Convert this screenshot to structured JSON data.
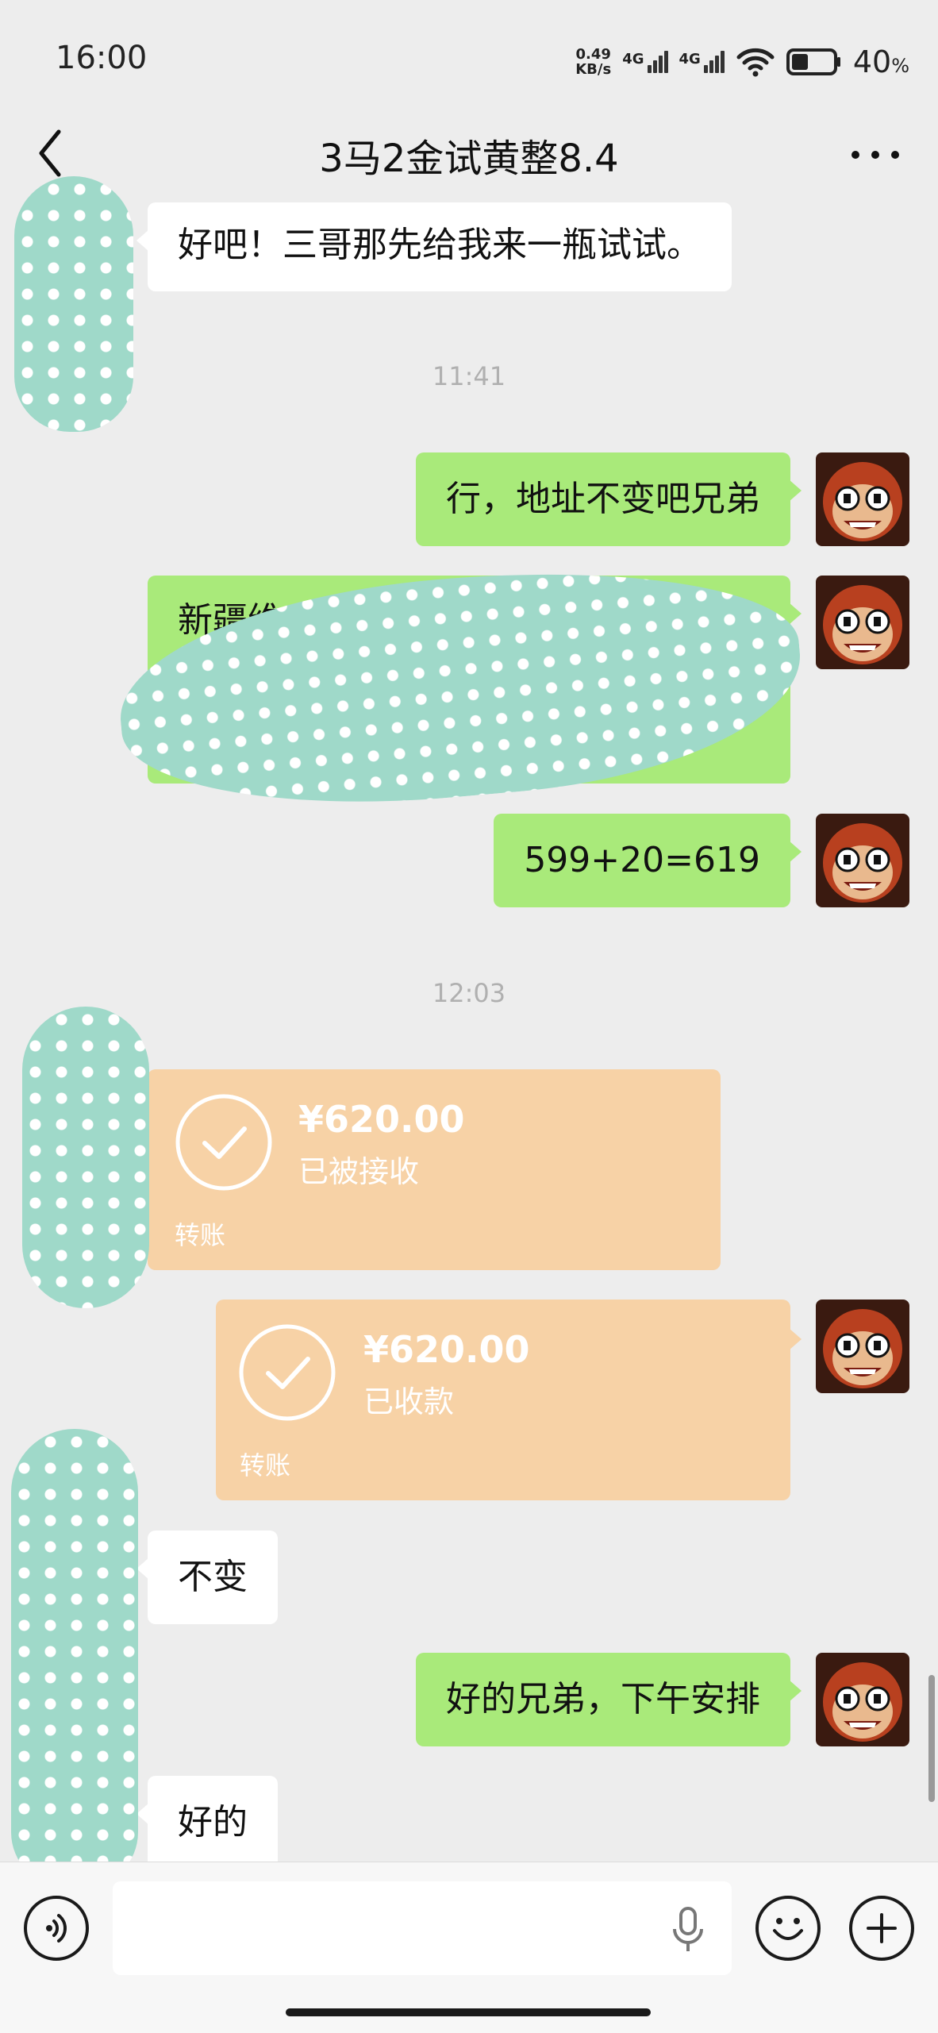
{
  "status_bar": {
    "time": "16:00",
    "speed_value": "0.49",
    "speed_unit": "KB/s",
    "network_1": "4G",
    "network_2": "4G",
    "battery_level": 0.4,
    "battery_text": "40",
    "battery_unit": "%"
  },
  "header": {
    "title": "3马2金试黄整8.4"
  },
  "colors": {
    "background": "#ededed",
    "sent_bubble": "#a9ea7a",
    "received_bubble": "#ffffff",
    "transfer_card": "#f7d2a6",
    "redaction": "#9fd9c9"
  },
  "messages": [
    {
      "text": "好吧！三哥那先给我来一瓶试试。"
    },
    {
      "timestamp": "11:41"
    },
    {
      "text": "行，地址不变吧兄弟"
    },
    {
      "text": "新疆维"
    },
    {
      "text": "599+20=619"
    },
    {
      "timestamp": "12:03"
    },
    {
      "amount": "¥620.00",
      "status": "已被接收",
      "label": "转账"
    },
    {
      "amount": "¥620.00",
      "status": "已收款",
      "label": "转账"
    },
    {
      "text": "不变"
    },
    {
      "text": "好的兄弟，下午安排"
    },
    {
      "text": "好的"
    }
  ],
  "input_bar": {
    "placeholder": "",
    "icons": [
      "voice-icon",
      "microphone-icon",
      "emoji-icon",
      "plus-icon"
    ]
  }
}
